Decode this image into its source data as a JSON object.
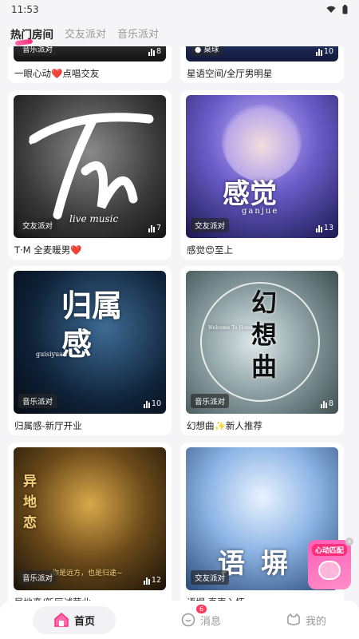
{
  "status": {
    "time": "11:53"
  },
  "tabs": [
    {
      "label": "热门房间"
    },
    {
      "label": "交友派对"
    },
    {
      "label": "音乐派对"
    }
  ],
  "rooms": [
    {
      "tag": "音乐派对",
      "count": "8",
      "title": "一眼心动❤️点唱交友"
    },
    {
      "tag": "桌球",
      "count": "10",
      "title": "星语空间/全厅男明星"
    },
    {
      "tag": "交友派对",
      "count": "7",
      "title": "T·M 全麦暖男❤️",
      "cover_text": "live music"
    },
    {
      "tag": "交友派对",
      "count": "13",
      "title": "感觉😍至上",
      "cover_text": "感觉",
      "cover_sub": "ganjue"
    },
    {
      "tag": "音乐派对",
      "count": "10",
      "title": "归属感-新厅开业",
      "cover_text": "归属感",
      "cover_sub": "guisiyuan"
    },
    {
      "tag": "音乐派对",
      "count": "8",
      "title": "幻想曲✨新人推荐",
      "cover_text": "幻想曲",
      "cover_sub": "Welcome To Home"
    },
    {
      "tag": "音乐派对",
      "count": "12",
      "title": "异地恋/新厅试营业",
      "cover_text": "异地恋",
      "cover_sub": "你是远方，也是归途~"
    },
    {
      "tag": "交友派对",
      "count": "",
      "title": "语塀·直声入怀",
      "cover_text": "语塀"
    }
  ],
  "bottom_nav": {
    "home": "首页",
    "messages": "消息",
    "messages_badge": "6",
    "mine": "我的"
  },
  "float_widget": {
    "label": "心动匹配"
  },
  "colors": {
    "accent": "#ff2d7a",
    "background": "#f5f5f7"
  }
}
